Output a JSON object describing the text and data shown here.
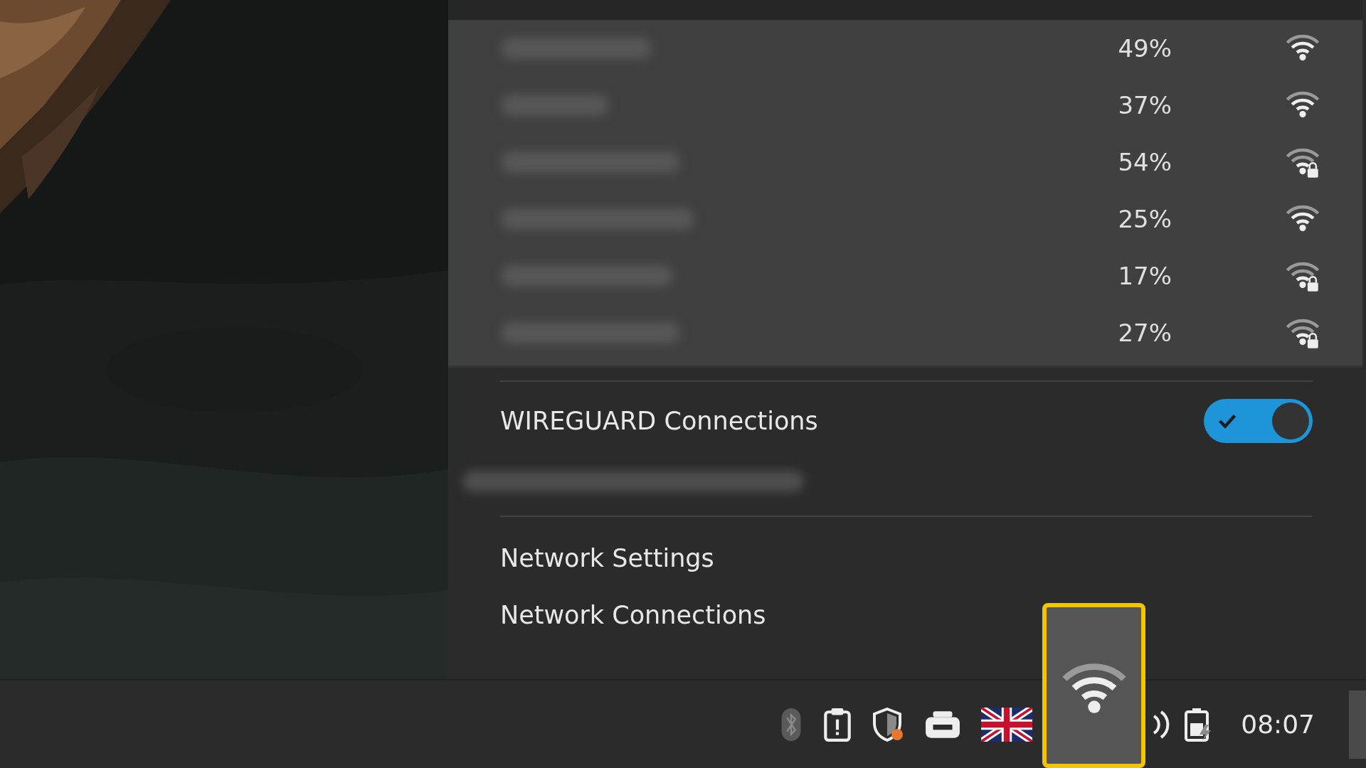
{
  "networks": [
    {
      "strength": "49%",
      "secured": false
    },
    {
      "strength": "37%",
      "secured": false
    },
    {
      "strength": "54%",
      "secured": true
    },
    {
      "strength": "25%",
      "secured": false
    },
    {
      "strength": "17%",
      "secured": true
    },
    {
      "strength": "27%",
      "secured": true
    }
  ],
  "wireguard": {
    "label": "WIREGUARD Connections",
    "on": true
  },
  "menu_items": [
    "Network Settings",
    "Network Connections"
  ],
  "taskbar": {
    "clock": "08:07"
  }
}
